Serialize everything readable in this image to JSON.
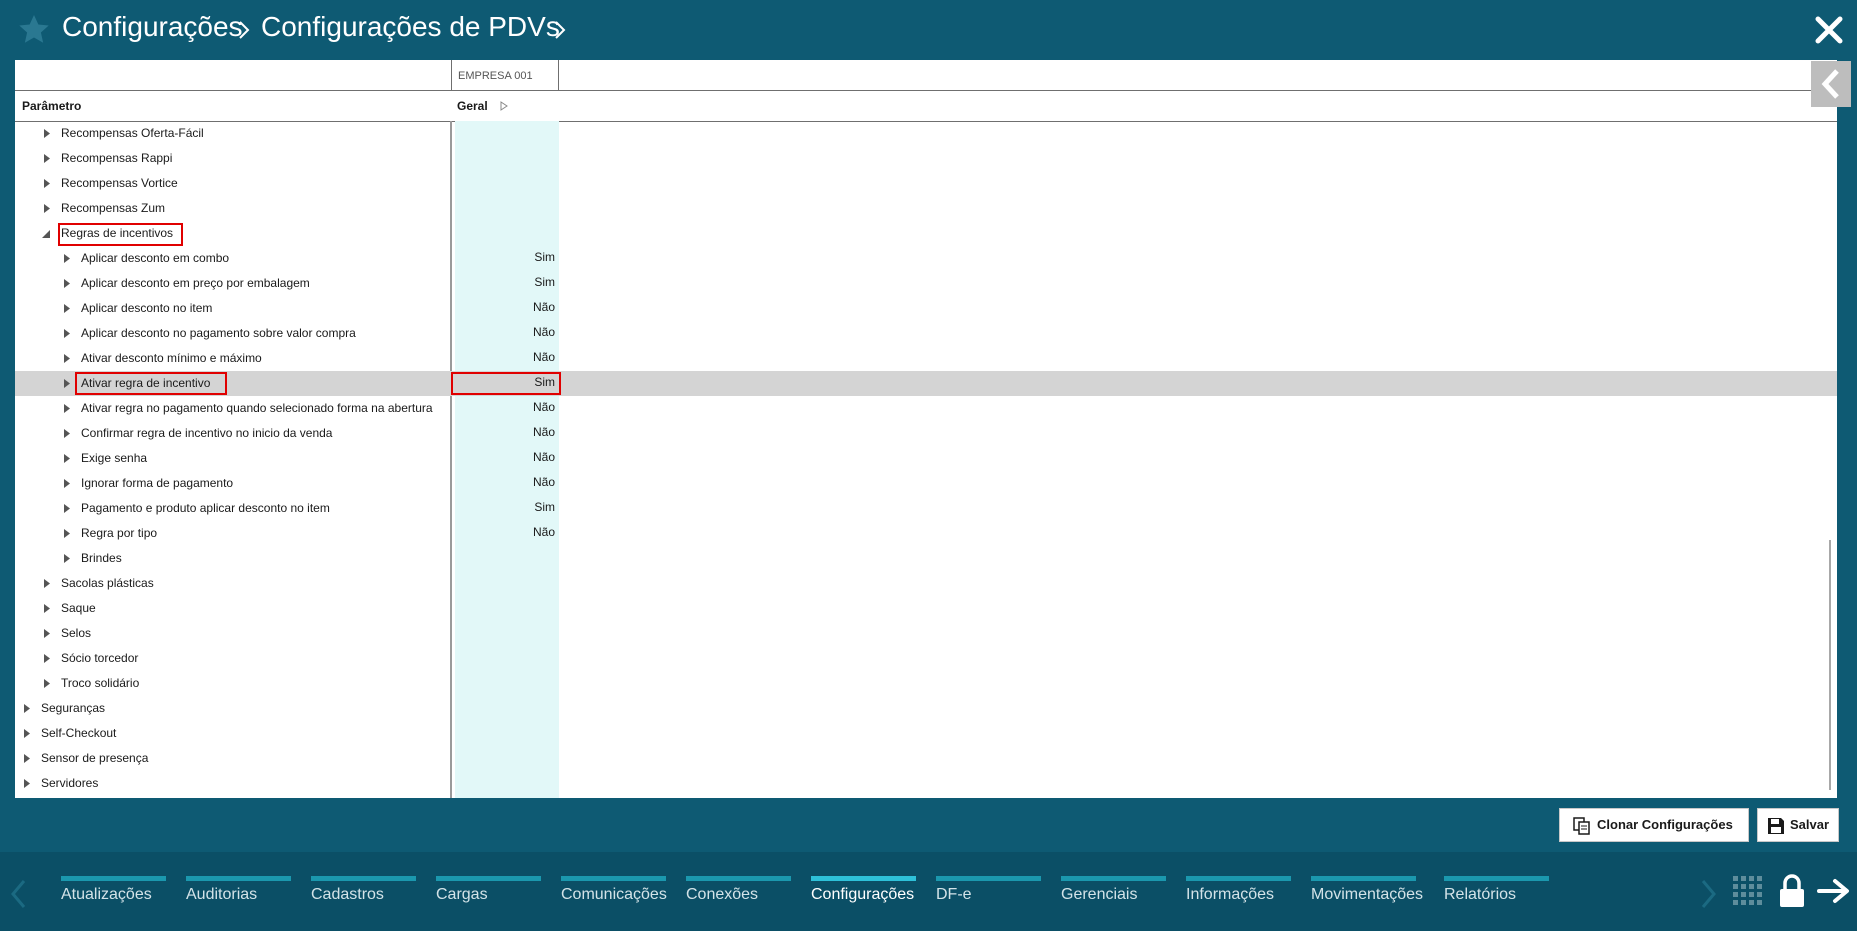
{
  "breadcrumb": {
    "level1": "Configurações",
    "level2": "Configurações de PDVs"
  },
  "table": {
    "company": "EMPRESA 001",
    "param_header": "Parâmetro",
    "value_header": "Geral",
    "rows": [
      {
        "label": "Recompensas Oferta-Fácil",
        "value": ""
      },
      {
        "label": "Recompensas Rappi",
        "value": ""
      },
      {
        "label": "Recompensas Vortice",
        "value": ""
      },
      {
        "label": "Recompensas Zum",
        "value": ""
      },
      {
        "label": "Regras de incentivos",
        "value": ""
      },
      {
        "label": "Aplicar desconto em combo",
        "value": "Sim"
      },
      {
        "label": "Aplicar desconto em preço por embalagem",
        "value": "Sim"
      },
      {
        "label": "Aplicar desconto no item",
        "value": "Não"
      },
      {
        "label": "Aplicar desconto no pagamento sobre valor compra",
        "value": "Não"
      },
      {
        "label": "Ativar desconto mínimo e máximo",
        "value": "Não"
      },
      {
        "label": "Ativar regra de incentivo",
        "value": "Sim"
      },
      {
        "label": "Ativar regra no pagamento quando selecionado forma na abertura",
        "value": "Não"
      },
      {
        "label": "Confirmar regra de incentivo no inicio da venda",
        "value": "Não"
      },
      {
        "label": "Exige senha",
        "value": "Não"
      },
      {
        "label": "Ignorar forma de pagamento",
        "value": "Não"
      },
      {
        "label": "Pagamento e produto aplicar desconto no item",
        "value": "Sim"
      },
      {
        "label": "Regra por tipo",
        "value": "Não"
      },
      {
        "label": "Brindes",
        "value": ""
      },
      {
        "label": "Sacolas plásticas",
        "value": ""
      },
      {
        "label": "Saque",
        "value": ""
      },
      {
        "label": "Selos",
        "value": ""
      },
      {
        "label": "Sócio torcedor",
        "value": ""
      },
      {
        "label": "Troco solidário",
        "value": ""
      },
      {
        "label": "Seguranças",
        "value": ""
      },
      {
        "label": "Self-Checkout",
        "value": ""
      },
      {
        "label": "Sensor de presença",
        "value": ""
      },
      {
        "label": "Servidores",
        "value": ""
      }
    ]
  },
  "actions": {
    "clone": "Clonar Configurações",
    "save": "Salvar"
  },
  "nav": {
    "items": [
      {
        "label": "Atualizações"
      },
      {
        "label": "Auditorias"
      },
      {
        "label": "Cadastros"
      },
      {
        "label": "Cargas"
      },
      {
        "label": "Comunicações"
      },
      {
        "label": "Conexões"
      },
      {
        "label": "Configurações"
      },
      {
        "label": "DF-e"
      },
      {
        "label": "Gerenciais"
      },
      {
        "label": "Informações"
      },
      {
        "label": "Movimentações"
      },
      {
        "label": "Relatórios"
      }
    ],
    "active": "Configurações"
  },
  "colors": {
    "header_bg": "#0e5a73",
    "nav_bg": "#0b4f66",
    "value_column_bg": "#e2f8f8",
    "selected_row_bg": "#d4d4d4",
    "highlight_border": "#e00000",
    "nav_accent": "#1b98ae"
  }
}
